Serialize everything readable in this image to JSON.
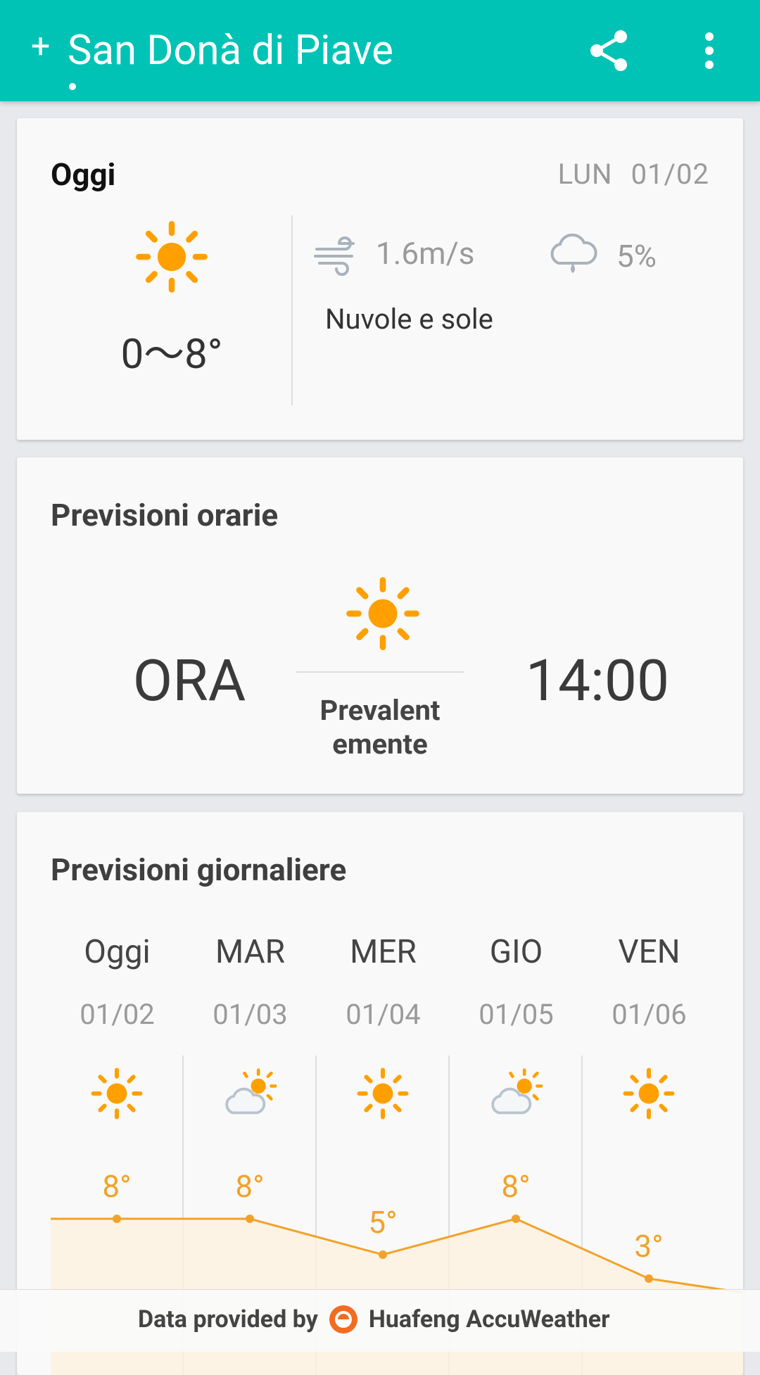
{
  "app_bar": {
    "title": "San Donà di Piave",
    "add_glyph": "+",
    "share_icon": "share-icon",
    "more_icon": "more-vert-icon",
    "accent": "#00c3b6"
  },
  "today": {
    "title": "Oggi",
    "weekday": "LUN",
    "date": "01/02",
    "temp_range": "0〜8°",
    "wind": "1.6m/s",
    "precip": "5%",
    "description": "Nuvole e sole",
    "icon": "sun-icon"
  },
  "hourly": {
    "title": "Previsioni orarie",
    "now_label": "ORA",
    "condition": "Prevalent emente",
    "time": "14:00",
    "icon": "sun-icon"
  },
  "daily": {
    "title": "Previsioni giornaliere",
    "days": [
      {
        "name": "Oggi",
        "date": "01/02",
        "icon": "sun-icon",
        "high": "8°"
      },
      {
        "name": "MAR",
        "date": "01/03",
        "icon": "partly-cloudy-icon",
        "high": "8°"
      },
      {
        "name": "MER",
        "date": "01/04",
        "icon": "sun-icon",
        "high": "5°"
      },
      {
        "name": "GIO",
        "date": "01/05",
        "icon": "partly-cloudy-icon",
        "high": "8°"
      },
      {
        "name": "VEN",
        "date": "01/06",
        "icon": "sun-icon",
        "high": "3°"
      }
    ],
    "high_temps": [
      8,
      8,
      5,
      8,
      3
    ],
    "line_color": "#f2a22a"
  },
  "footer": {
    "prefix": "Data provided by",
    "provider": "Huafeng AccuWeather"
  }
}
